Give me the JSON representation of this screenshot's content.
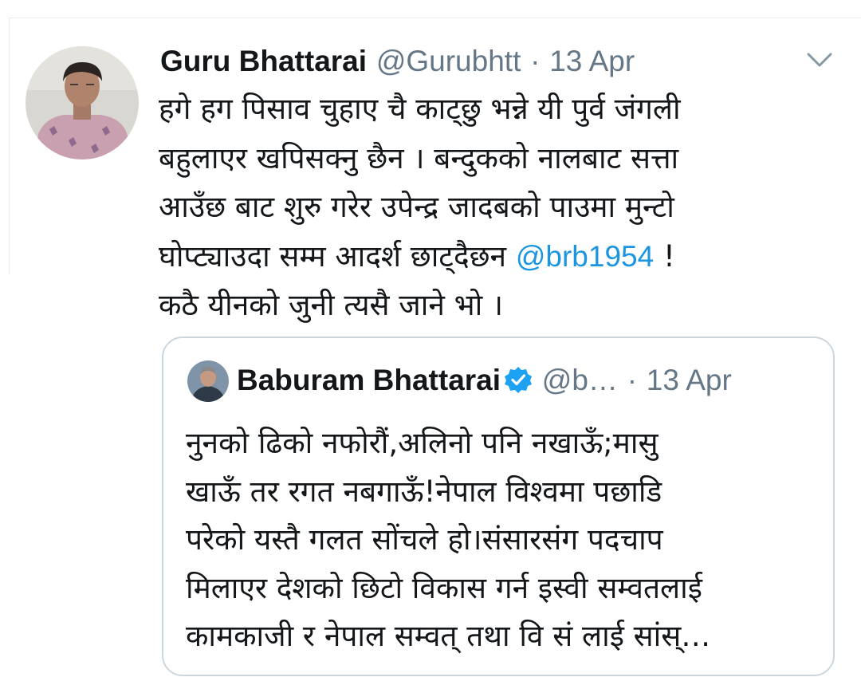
{
  "tweet": {
    "author_name": "Guru Bhattarai",
    "handle": "@Gurubhtt",
    "separator": "·",
    "date": "13 Apr",
    "menu_icon": "chevron-down-icon",
    "text_lines": [
      "हगे हग पिसाव चुहाए चै काट्छु भन्ने यी पुर्व जंगली",
      "बहुलाएर खपिसक्नु छैन । बन्दुकको नालबाट सत्ता",
      "आउँछ बाट शुरु गरेर उपेन्द्र जादबको पाउमा मुन्टो"
    ],
    "line4_text": "घोप्ट्याउदा सम्म आदर्श छाट्दैछन ",
    "mention": "@brb1954",
    "line4_after": " !",
    "line5_text": "कठै यीनको जुनी त्यसै जाने भो ।",
    "colors": {
      "text": "#14171a",
      "muted": "#657786",
      "link": "#1b95e0",
      "border": "#ccd6dd"
    }
  },
  "quoted_tweet": {
    "author_name": "Baburam Bhattarai",
    "verified_icon": "verified-badge-icon",
    "handle": "@b…",
    "separator": "·",
    "date": "13 Apr",
    "text_lines": [
      "नुनको ढिको नफोरौं,अलिनो पनि नखाऊँ;मासु",
      "खाऊँ तर रगत नबगाऊँ!नेपाल विश्वमा पछाडि",
      "परेको यस्तै गलत सोंचले हो।संसारसंग पदचाप",
      "मिलाएर देशको छिटो विकास गर्न इस्वी सम्वतलाई",
      "कामकाजी र नेपाल सम्वत् तथा वि सं लाई सांस्…"
    ],
    "colors": {
      "verified": "#1da1f2"
    }
  }
}
